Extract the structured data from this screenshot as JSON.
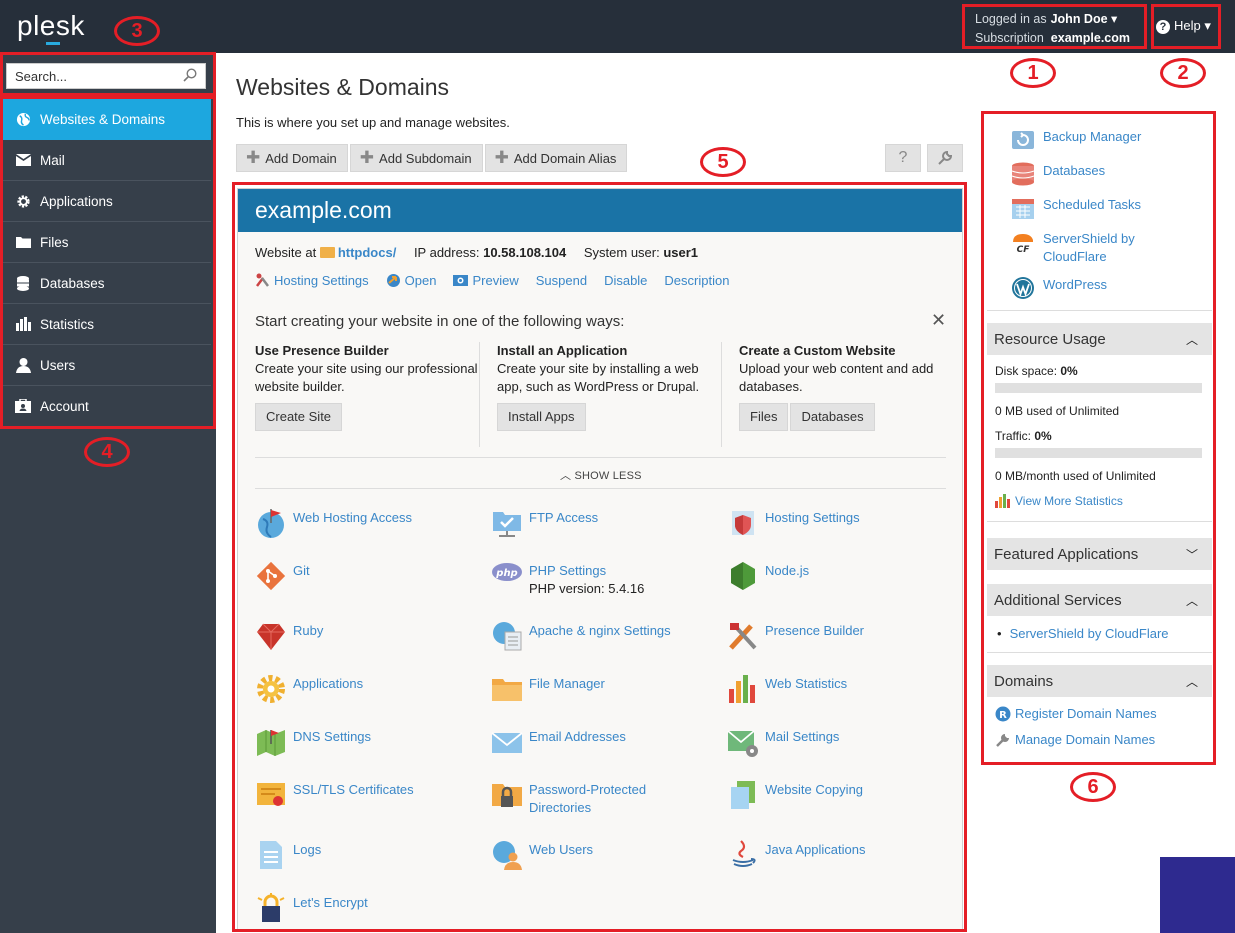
{
  "brand": {
    "name": "plesk"
  },
  "header": {
    "logged_in_label": "Logged in as",
    "user_name": "John Doe",
    "subscription_label": "Subscription",
    "subscription_value": "example.com",
    "help_label": "Help"
  },
  "sidebar": {
    "search_placeholder": "Search...",
    "items": [
      {
        "label": "Websites & Domains",
        "icon": "globe-icon",
        "active": true
      },
      {
        "label": "Mail",
        "icon": "envelope-icon"
      },
      {
        "label": "Applications",
        "icon": "gear-icon"
      },
      {
        "label": "Files",
        "icon": "folder-icon"
      },
      {
        "label": "Databases",
        "icon": "database-icon"
      },
      {
        "label": "Statistics",
        "icon": "bar-chart-icon"
      },
      {
        "label": "Users",
        "icon": "user-icon"
      },
      {
        "label": "Account",
        "icon": "id-card-icon"
      }
    ]
  },
  "annotations": [
    "1",
    "2",
    "3",
    "4",
    "5",
    "6"
  ],
  "main": {
    "title": "Websites & Domains",
    "description": "This is where you set up and manage websites.",
    "toolbar": [
      "Add Domain",
      "Add Subdomain",
      "Add Domain Alias"
    ],
    "help_glyph": "?",
    "domain": {
      "name": "example.com",
      "website_at_label": "Website at",
      "docroot": "httpdocs/",
      "ip_label": "IP address:",
      "ip_value": "10.58.108.104",
      "sysuser_label": "System user:",
      "sysuser_value": "user1",
      "actions": [
        "Hosting Settings",
        "Open",
        "Preview",
        "Suspend",
        "Disable",
        "Description"
      ]
    },
    "start": {
      "title": "Start creating your website in one of the following ways:",
      "options": [
        {
          "title": "Use Presence Builder",
          "text": "Create your site using our professional website builder.",
          "buttons": [
            "Create Site"
          ]
        },
        {
          "title": "Install an Application",
          "text": "Create your site by installing a web app, such as WordPress or Drupal.",
          "buttons": [
            "Install Apps"
          ]
        },
        {
          "title": "Create a Custom Website",
          "text": "Upload your web content and add databases.",
          "buttons": [
            "Files",
            "Databases"
          ]
        }
      ],
      "show_less": "SHOW LESS"
    },
    "tools": [
      {
        "label": "Web Hosting Access",
        "icon": "globe-flag-icon"
      },
      {
        "label": "FTP Access",
        "icon": "ftp-folder-icon"
      },
      {
        "label": "Hosting Settings",
        "icon": "hosting-shield-icon"
      },
      {
        "label": "Git",
        "icon": "git-icon"
      },
      {
        "label": "PHP Settings",
        "sub": "PHP version: 5.4.16",
        "icon": "php-icon"
      },
      {
        "label": "Node.js",
        "icon": "nodejs-icon"
      },
      {
        "label": "Ruby",
        "icon": "ruby-icon"
      },
      {
        "label": "Apache & nginx Settings",
        "icon": "apache-icon"
      },
      {
        "label": "Presence Builder",
        "icon": "builder-tools-icon"
      },
      {
        "label": "Applications",
        "icon": "gear-icon"
      },
      {
        "label": "File Manager",
        "icon": "folder-icon"
      },
      {
        "label": "Web Statistics",
        "icon": "bar-chart-icon"
      },
      {
        "label": "DNS Settings",
        "icon": "dns-icon"
      },
      {
        "label": "Email Addresses",
        "icon": "envelope-icon"
      },
      {
        "label": "Mail Settings",
        "icon": "mail-settings-icon"
      },
      {
        "label": "SSL/TLS Certificates",
        "icon": "certificate-icon"
      },
      {
        "label": "Password-Protected Directories",
        "icon": "locked-folder-icon"
      },
      {
        "label": "Website Copying",
        "icon": "copy-icon"
      },
      {
        "label": "Logs",
        "icon": "log-file-icon"
      },
      {
        "label": "Web Users",
        "icon": "web-users-icon"
      },
      {
        "label": "Java Applications",
        "icon": "java-icon"
      },
      {
        "label": "Let's Encrypt",
        "icon": "lets-encrypt-icon"
      }
    ]
  },
  "right": {
    "shortcuts": [
      {
        "label": "Backup Manager",
        "icon": "backup-icon"
      },
      {
        "label": "Databases",
        "icon": "database-icon"
      },
      {
        "label": "Scheduled Tasks",
        "icon": "calendar-icon"
      },
      {
        "label": "ServerShield by CloudFlare",
        "icon": "cloudflare-icon"
      },
      {
        "label": "WordPress",
        "icon": "wordpress-icon"
      }
    ],
    "resource": {
      "title": "Resource Usage",
      "disk_label": "Disk space:",
      "disk_value": "0%",
      "disk_fraction": 0,
      "disk_used": "0 MB used of Unlimited",
      "traffic_label": "Traffic:",
      "traffic_value": "0%",
      "traffic_fraction": 0,
      "traffic_used": "0 MB/month used of Unlimited",
      "more_stats": "View More Statistics"
    },
    "featured": {
      "title": "Featured Applications"
    },
    "additional": {
      "title": "Additional Services",
      "items": [
        "ServerShield by CloudFlare"
      ]
    },
    "domains": {
      "title": "Domains",
      "register": "Register Domain Names",
      "manage": "Manage Domain Names"
    }
  }
}
